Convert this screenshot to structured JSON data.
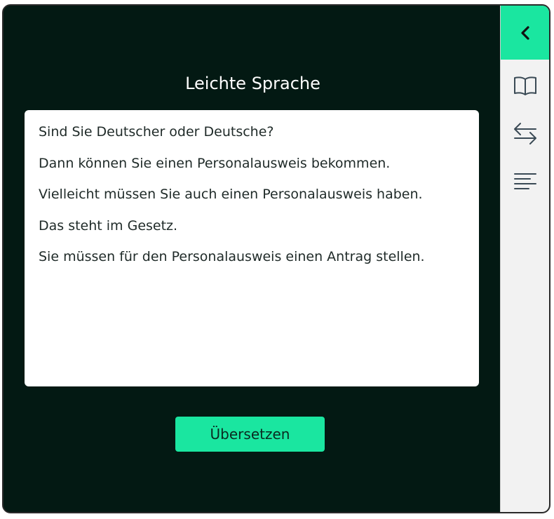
{
  "main": {
    "title": "Leichte Sprache",
    "paragraphs": [
      "Sind Sie Deutscher oder Deutsche?",
      "Dann können Sie einen Personalausweis bekommen.",
      "Vielleicht müssen Sie auch einen Personalausweis haben.",
      "Das steht im Gesetz.",
      "Sie müssen für den Personalausweis einen Antrag stellen."
    ],
    "translate_button_label": "Übersetzen"
  },
  "sidebar": {
    "icons": [
      "chevron-left-icon",
      "book-icon",
      "swap-arrows-icon",
      "text-align-left-icon"
    ]
  },
  "colors": {
    "background": "#031913",
    "accent": "#1ae6a0",
    "panel": "#ffffff",
    "sidebar": "#f2f2f2"
  }
}
